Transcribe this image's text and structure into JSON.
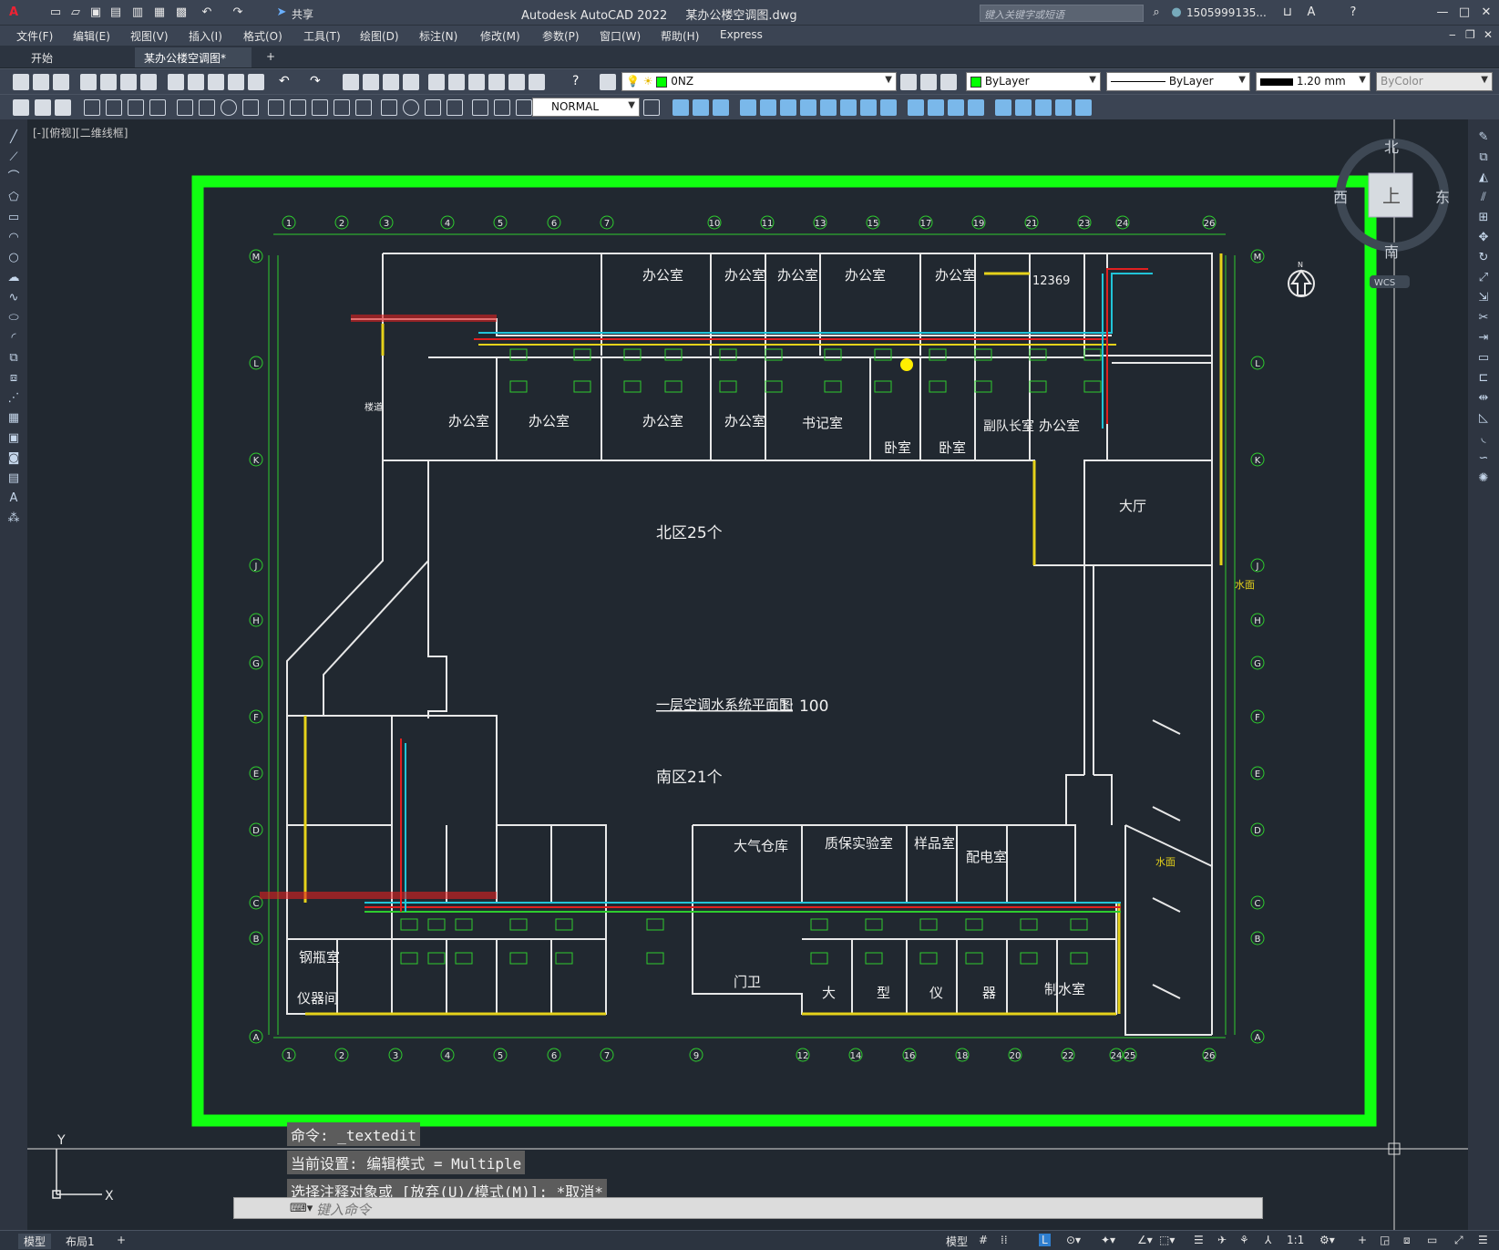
{
  "titlebar": {
    "app_name": "Autodesk AutoCAD 2022",
    "file_name": "某办公楼空调图.dwg",
    "search_placeholder": "键入关键字或短语",
    "user": "1505999135...",
    "share_label": "共享"
  },
  "menu": [
    "文件(F)",
    "编辑(E)",
    "视图(V)",
    "插入(I)",
    "格式(O)",
    "工具(T)",
    "绘图(D)",
    "标注(N)",
    "修改(M)",
    "参数(P)",
    "窗口(W)",
    "帮助(H)",
    "Express"
  ],
  "tabs": {
    "start": "开始",
    "doc": "某办公楼空调图*"
  },
  "props": {
    "layer": "0NZ",
    "color": "ByLayer",
    "linetype": "ByLayer",
    "lineweight": "1.20 mm",
    "plotstyle": "ByColor",
    "textstyle": "NORMAL"
  },
  "viewport": {
    "label": "[-][俯视][二维线框]"
  },
  "viewcube": {
    "north": "北",
    "south": "南",
    "east": "东",
    "west": "西",
    "top": "上",
    "wcs": "WCS"
  },
  "drawing": {
    "title": "一层空调水系统平面图",
    "scale": "1: 100",
    "north_count": "北区25个",
    "south_count": "南区21个",
    "north_arrow": "N",
    "rooms": {
      "office": "办公室",
      "secretary": "书记室",
      "bedroom": "卧室",
      "deputy": "副队长室",
      "lobby": "大厅",
      "hotline": "12369",
      "stairs": "楼道",
      "water": "水面",
      "air_store": "大气仓库",
      "qa_lab": "质保实验室",
      "sample": "样品室",
      "power": "配电室",
      "cylinder": "钢瓶室",
      "instrument": "仪器间",
      "gate": "门卫",
      "big": "大",
      "type": "型",
      "inst": "仪",
      "device": "器",
      "prep": "制水室"
    },
    "top_axes": [
      "1",
      "2",
      "3",
      "4",
      "5",
      "6",
      "7",
      "10",
      "11",
      "13",
      "15",
      "17",
      "19",
      "21",
      "23",
      "24",
      "26"
    ],
    "bottom_axes": [
      "1",
      "2",
      "3",
      "4",
      "5",
      "6",
      "7",
      "9",
      "12",
      "14",
      "16",
      "18",
      "20",
      "22",
      "24",
      "25",
      "26"
    ],
    "side_axes": [
      "M",
      "L",
      "K",
      "J",
      "H",
      "G",
      "F",
      "E",
      "D",
      "C",
      "B",
      "A"
    ]
  },
  "command": {
    "line1": "命令: _textedit",
    "line2": "当前设置: 编辑模式 = Multiple",
    "line3": "选择注释对象或 [放弃(U)/模式(M)]: *取消*",
    "placeholder": "键入命令"
  },
  "status": {
    "model_tab": "模型",
    "layout_tab": "布局1",
    "model_btn": "模型",
    "scale": "1:1"
  }
}
